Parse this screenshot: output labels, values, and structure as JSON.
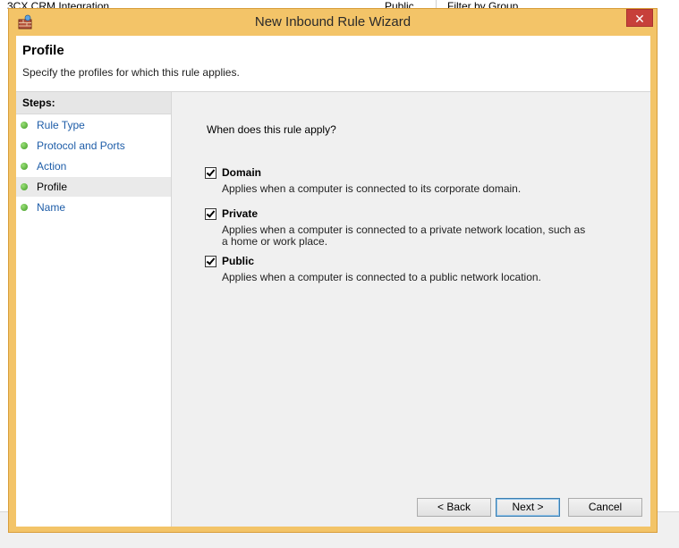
{
  "background": {
    "row_name": "3CX CRM Integration",
    "row_profile": "Public",
    "filter_label": "Filter by Group"
  },
  "window": {
    "title": "New Inbound Rule Wizard",
    "close_glyph": "✕"
  },
  "header": {
    "title": "Profile",
    "description": "Specify the profiles for which this rule applies."
  },
  "steps": {
    "heading": "Steps:",
    "items": [
      {
        "label": "Rule Type"
      },
      {
        "label": "Protocol and Ports"
      },
      {
        "label": "Action"
      },
      {
        "label": "Profile"
      },
      {
        "label": "Name"
      }
    ],
    "current_index": 3
  },
  "main": {
    "question": "When does this rule apply?",
    "options": [
      {
        "name": "Domain",
        "checked": true,
        "description": "Applies when a computer is connected to its corporate domain."
      },
      {
        "name": "Private",
        "checked": true,
        "description": "Applies when a computer is connected to a private network location, such as a home or work place."
      },
      {
        "name": "Public",
        "checked": true,
        "description": "Applies when a computer is connected to a public network location."
      }
    ]
  },
  "buttons": {
    "back": "< Back",
    "next": "Next >",
    "cancel": "Cancel"
  }
}
